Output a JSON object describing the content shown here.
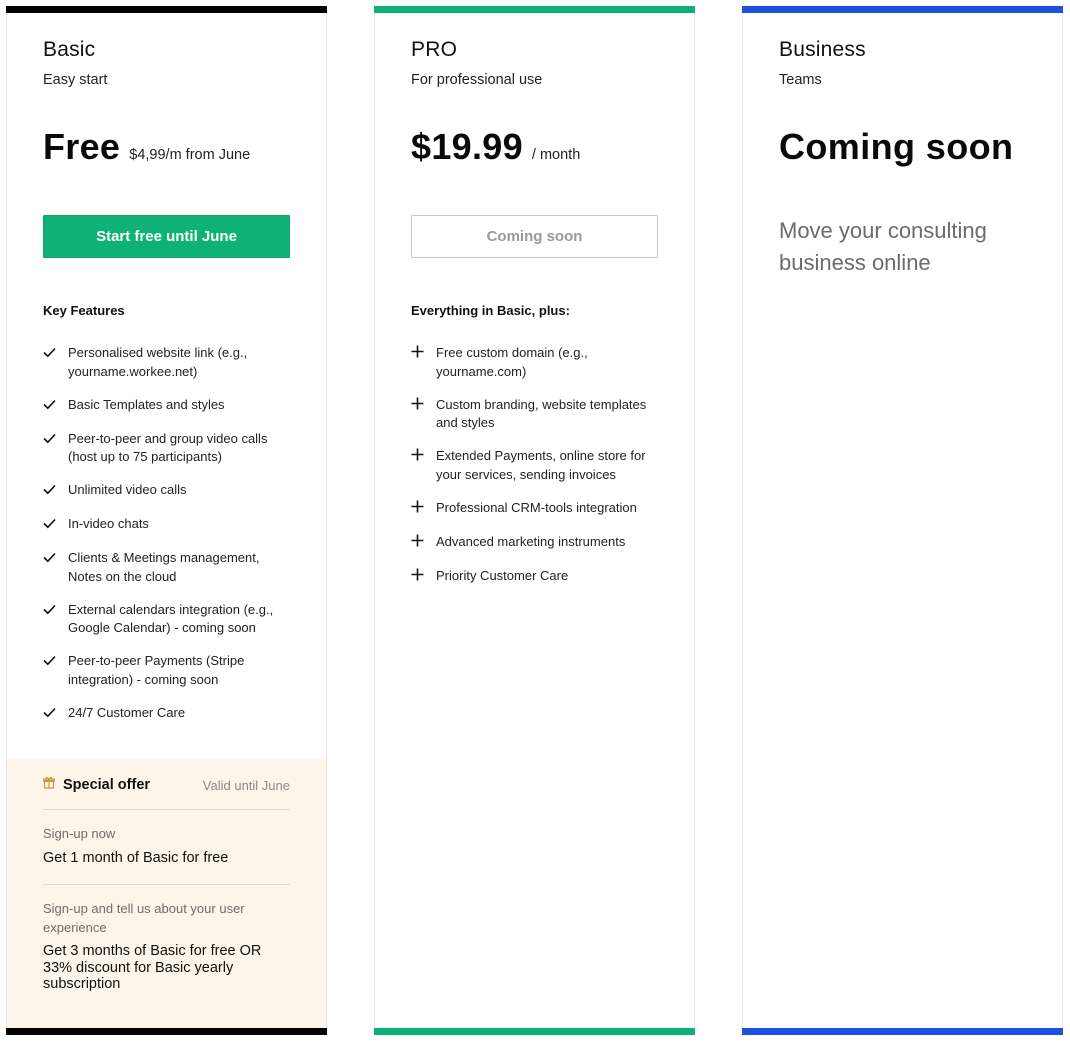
{
  "colors": {
    "basic_accent": "#000000",
    "pro_accent": "#0fb276",
    "business_accent": "#1f4fe0",
    "offer_bg": "#fdf5ea"
  },
  "basic": {
    "name": "Basic",
    "subtitle": "Easy start",
    "price": "Free",
    "price_note": "$4,99/m from June",
    "cta": "Start free until June",
    "features_title": "Key Features",
    "features": [
      "Personalised website link (e.g., yourname.workee.net)",
      "Basic Templates and styles",
      "Peer-to-peer and group video calls (host up to 75 participants)",
      "Unlimited video calls",
      "In-video chats",
      "Clients & Meetings management, Notes on the cloud",
      "External calendars integration (e.g., Google Calendar) - coming soon",
      "Peer-to-peer Payments (Stripe integration) - coming soon",
      "24/7 Customer Care"
    ],
    "feature_icon": "check-icon",
    "offer": {
      "icon": "gift-icon",
      "title": "Special offer",
      "valid": "Valid until June",
      "items": [
        {
          "label": "Sign-up now",
          "text": "Get 1 month of Basic for free"
        },
        {
          "label": "Sign-up and tell us about your user experience",
          "text": "Get 3 months of Basic for free OR 33% discount for Basic yearly subscription"
        }
      ]
    }
  },
  "pro": {
    "name": "PRO",
    "subtitle": "For professional use",
    "price": "$19.99",
    "price_note": "/ month",
    "cta": "Coming soon",
    "features_title": "Everything in Basic, plus:",
    "features": [
      "Free custom domain (e.g., yourname.com)",
      "Custom branding, website templates and styles",
      "Extended Payments, online store for your services, sending invoices",
      "Professional CRM-tools integration",
      "Advanced marketing instruments",
      "Priority Customer Care"
    ],
    "feature_icon": "plus-icon"
  },
  "business": {
    "name": "Business",
    "subtitle": "Teams",
    "headline": "Coming soon",
    "tagline": "Move your consulting business online"
  }
}
